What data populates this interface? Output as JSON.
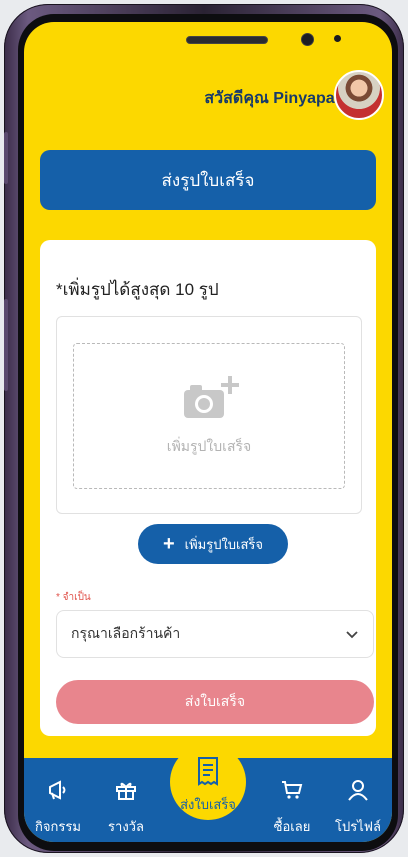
{
  "header": {
    "greeting": "สวัสดีคุณ Pinyapat"
  },
  "title_card": {
    "label": "ส่งรูปใบเสร็จ"
  },
  "form": {
    "max_photos_label": "*เพิ่มรูปได้สูงสุด 10 รูป",
    "upload_placeholder": "เพิ่มรูปใบเสร็จ",
    "add_photo_button": "เพิ่มรูปใบเสร็จ",
    "required_label": "* จำเป็น",
    "store_select_placeholder": "กรุณาเลือกร้านค้า",
    "submit_button": "ส่งใบเสร็จ"
  },
  "bottom_nav": {
    "items": [
      {
        "label": "กิจกรรม",
        "icon": "megaphone-icon"
      },
      {
        "label": "รางวัล",
        "icon": "gift-icon"
      },
      {
        "label": "ส่งใบเสร็จ",
        "icon": "receipt-icon"
      },
      {
        "label": "ซื้อเลย",
        "icon": "cart-icon"
      },
      {
        "label": "โปรไฟล์",
        "icon": "person-icon"
      }
    ]
  },
  "colors": {
    "background": "#fcd800",
    "primary": "#1560a9",
    "submit_disabled": "#e8858d",
    "required": "#e0524a"
  }
}
